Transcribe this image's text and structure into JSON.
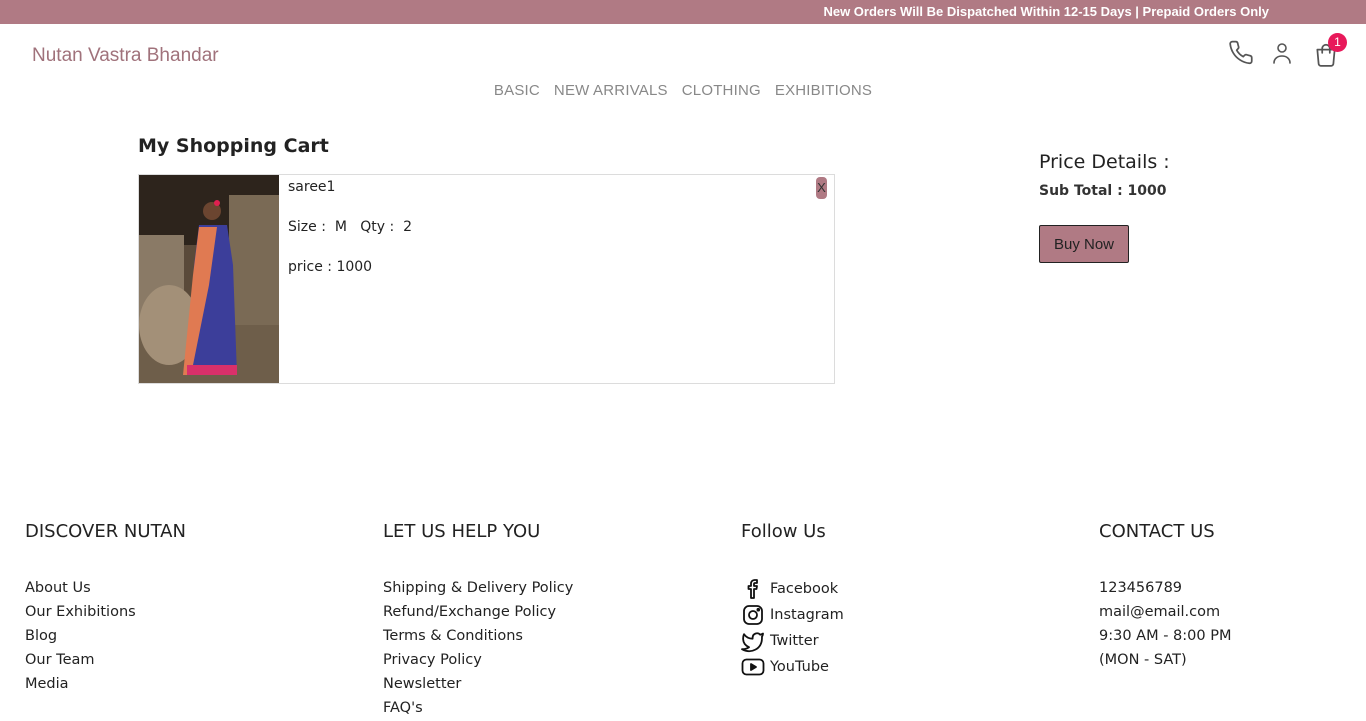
{
  "topbar": {
    "announcement": "New Orders Will Be Dispatched Within 12-15 Days | Prepaid Orders Only"
  },
  "header": {
    "brand": "Nutan Vastra Bhandar",
    "cart_count": "1",
    "icons": [
      "phone-icon",
      "user-icon",
      "shopping-bag-icon"
    ]
  },
  "nav": {
    "items": [
      "BASIC",
      "NEW ARRIVALS",
      "CLOTHING",
      "EXHIBITIONS"
    ]
  },
  "cart": {
    "title": "My Shopping Cart",
    "item": {
      "name": "saree1",
      "size_label": "Size :",
      "size": "M",
      "qty_label": "Qty :",
      "qty": "2",
      "price_text": "price : 1000",
      "remove_label": "X"
    }
  },
  "price_details": {
    "title": "Price Details :",
    "subtotal_text": "Sub Total : 1000",
    "buy_label": "Buy Now"
  },
  "footer": {
    "discover": {
      "title": "DISCOVER NUTAN",
      "links": [
        "About Us",
        "Our Exhibitions",
        "Blog",
        "Our Team",
        "Media"
      ]
    },
    "help": {
      "title": "LET US HELP YOU",
      "links": [
        "Shipping & Delivery Policy",
        "Refund/Exchange Policy",
        "Terms & Conditions",
        "Privacy Policy",
        "Newsletter",
        "FAQ's"
      ]
    },
    "follow": {
      "title": "Follow Us",
      "links": [
        "Facebook",
        "Instagram",
        "Twitter",
        "YouTube"
      ]
    },
    "contact": {
      "title": "CONTACT US",
      "lines": [
        "123456789",
        "mail@email.com",
        "9:30 AM - 8:00 PM",
        "(MON - SAT)"
      ]
    }
  },
  "colors": {
    "accent": "#b07a84",
    "badge": "#e8185a",
    "brand_text": "#a0727b"
  }
}
